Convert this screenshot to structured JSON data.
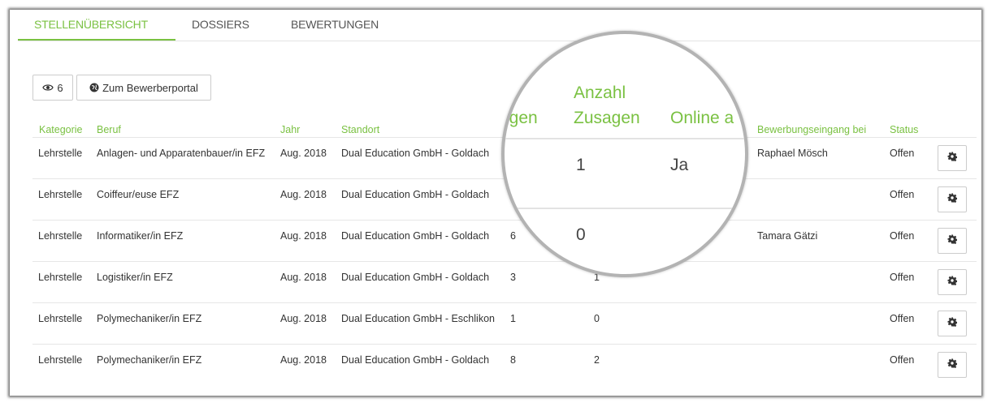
{
  "tabs": [
    {
      "label": "STELLENÜBERSICHT",
      "active": true
    },
    {
      "label": "DOSSIERS",
      "active": false
    },
    {
      "label": "BEWERTUNGEN",
      "active": false
    }
  ],
  "toolbar": {
    "view_count": "6",
    "portal_label": "Zum Bewerberportal"
  },
  "columns": {
    "kategorie": "Kategorie",
    "beruf": "Beruf",
    "jahr": "Jahr",
    "standort": "Standort",
    "eingang": "Bewerbungseingang bei",
    "status": "Status"
  },
  "rows": [
    {
      "kategorie": "Lehrstelle",
      "beruf": "Anlagen- und Apparatenbauer/in EFZ",
      "jahr": "Aug. 2018",
      "standort": "Dual Education GmbH - Goldach",
      "bewerbungen": "",
      "zusagen": "",
      "eingang": "Raphael Mösch",
      "status": "Offen"
    },
    {
      "kategorie": "Lehrstelle",
      "beruf": "Coiffeur/euse EFZ",
      "jahr": "Aug. 2018",
      "standort": "Dual Education GmbH - Goldach",
      "bewerbungen": "",
      "zusagen": "",
      "eingang": "",
      "status": "Offen"
    },
    {
      "kategorie": "Lehrstelle",
      "beruf": "Informatiker/in EFZ",
      "jahr": "Aug. 2018",
      "standort": "Dual Education GmbH - Goldach",
      "bewerbungen": "6",
      "zusagen": "",
      "eingang": "Tamara Gätzi",
      "status": "Offen"
    },
    {
      "kategorie": "Lehrstelle",
      "beruf": "Logistiker/in EFZ",
      "jahr": "Aug. 2018",
      "standort": "Dual Education GmbH - Goldach",
      "bewerbungen": "3",
      "zusagen": "1",
      "eingang": "",
      "status": "Offen"
    },
    {
      "kategorie": "Lehrstelle",
      "beruf": "Polymechaniker/in EFZ",
      "jahr": "Aug. 2018",
      "standort": "Dual Education GmbH - Eschlikon",
      "bewerbungen": "1",
      "zusagen": "0",
      "eingang": "",
      "status": "Offen"
    },
    {
      "kategorie": "Lehrstelle",
      "beruf": "Polymechaniker/in EFZ",
      "jahr": "Aug. 2018",
      "standort": "Dual Education GmbH - Goldach",
      "bewerbungen": "8",
      "zusagen": "2",
      "eingang": "",
      "status": "Offen"
    }
  ],
  "magnifier": {
    "col_partial_left": "ngen",
    "col_anzahl": "Anzahl",
    "col_zusagen": "Zusagen",
    "col_online": "Online a",
    "val_row1_zusagen": "1",
    "val_row1_online": "Ja",
    "val_row3_zusagen": "0"
  },
  "colors": {
    "accent": "#7ac142",
    "text": "#333333",
    "border": "#cccccc"
  },
  "icons": {
    "view": "eye-icon",
    "portal": "globe-icon",
    "settings": "gear-icon"
  }
}
